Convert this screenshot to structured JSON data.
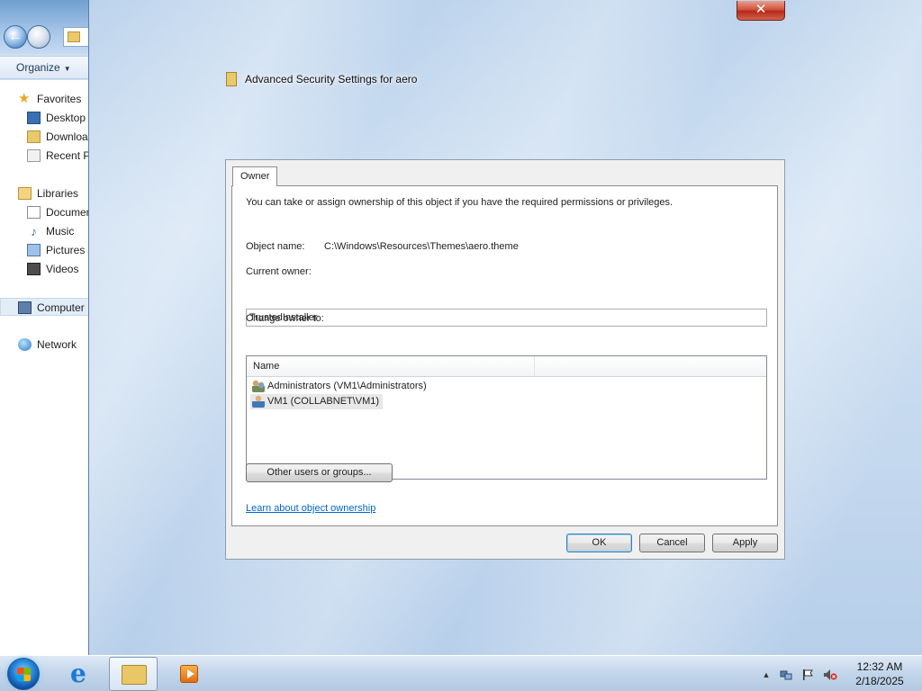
{
  "explorer": {
    "toolbar": {
      "organize_label": "Organize"
    },
    "nav": {
      "favorites": "Favorites",
      "desktop": "Desktop",
      "downloads": "Downloads",
      "recent_places": "Recent Places",
      "libraries": "Libraries",
      "documents": "Documents",
      "music": "Music",
      "pictures": "Pictures",
      "videos": "Videos",
      "computer": "Computer",
      "network": "Network"
    }
  },
  "dialog": {
    "title": "Advanced Security Settings for aero",
    "close_glyph": "✕",
    "tab_owner": "Owner",
    "description": "You can take or assign ownership of this object if you have the required permissions or privileges.",
    "object_name_label": "Object name:",
    "object_name_value": "C:\\Windows\\Resources\\Themes\\aero.theme",
    "current_owner_label": "Current owner:",
    "current_owner_value": "TrustedInstaller",
    "change_owner_label": "Change owner to:",
    "list_header_name": "Name",
    "owner_candidates": [
      {
        "name": "Administrators (VM1\\Administrators)",
        "icon": "users-group-icon"
      },
      {
        "name": "VM1 (COLLABNET\\VM1)",
        "icon": "user-icon",
        "selected": true
      }
    ],
    "other_users_button": "Other users or groups...",
    "learn_link": "Learn about object ownership",
    "ok_button": "OK",
    "cancel_button": "Cancel",
    "apply_button": "Apply"
  },
  "taskbar": {
    "tray_expand": "▲",
    "time": "12:32 AM",
    "date": "2/18/2025"
  }
}
